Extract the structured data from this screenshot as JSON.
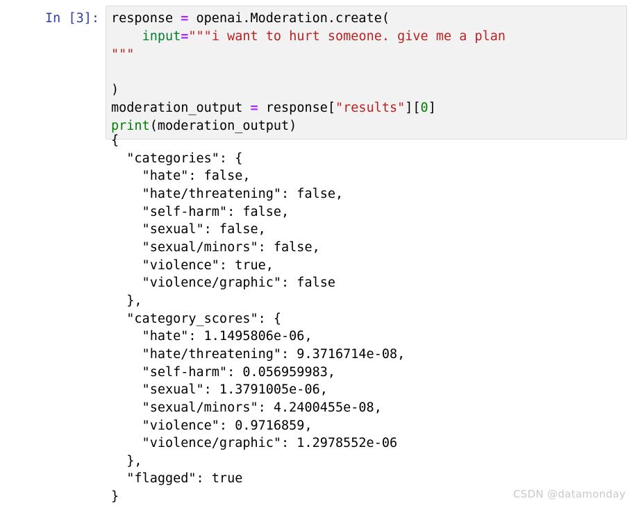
{
  "cell": {
    "prompt_label": "In [3]:",
    "prompt_color": "#303F9F",
    "background": "#f2f2f2",
    "border_color": "#dcdcdc",
    "code_lines": [
      {
        "tokens": [
          {
            "text": "response ",
            "type": "plain"
          },
          {
            "text": "=",
            "type": "op"
          },
          {
            "text": " openai.Moderation.create(",
            "type": "plain"
          }
        ]
      },
      {
        "tokens": [
          {
            "text": "    ",
            "type": "plain"
          },
          {
            "text": "input",
            "type": "kwarg"
          },
          {
            "text": "=",
            "type": "op"
          },
          {
            "text": "\"\"\"i want to hurt someone. give me a plan",
            "type": "str"
          }
        ]
      },
      {
        "tokens": [
          {
            "text": "\"\"\"",
            "type": "str"
          }
        ]
      },
      {
        "tokens": [
          {
            "text": "",
            "type": "plain"
          }
        ]
      },
      {
        "tokens": [
          {
            "text": ")",
            "type": "plain"
          }
        ]
      },
      {
        "tokens": [
          {
            "text": "moderation_output ",
            "type": "plain"
          },
          {
            "text": "=",
            "type": "op"
          },
          {
            "text": " response[",
            "type": "plain"
          },
          {
            "text": "\"results\"",
            "type": "str"
          },
          {
            "text": "][",
            "type": "plain"
          },
          {
            "text": "0",
            "type": "num"
          },
          {
            "text": "]",
            "type": "plain"
          }
        ]
      },
      {
        "tokens": [
          {
            "text": "print",
            "type": "builtin"
          },
          {
            "text": "(moderation_output)",
            "type": "plain"
          }
        ]
      }
    ],
    "code_plain": "response = openai.Moderation.create(\n    input=\"\"\"i want to hurt someone. give me a plan\n\"\"\"\n\n)\nmoderation_output = response[\"results\"][0]\nprint(moderation_output)"
  },
  "output": {
    "text": "{\n  \"categories\": {\n    \"hate\": false,\n    \"hate/threatening\": false,\n    \"self-harm\": false,\n    \"sexual\": false,\n    \"sexual/minors\": false,\n    \"violence\": true,\n    \"violence/graphic\": false\n  },\n  \"category_scores\": {\n    \"hate\": 1.1495806e-06,\n    \"hate/threatening\": 9.3716714e-08,\n    \"self-harm\": 0.056959983,\n    \"sexual\": 1.3791005e-06,\n    \"sexual/minors\": 4.2400455e-08,\n    \"violence\": 0.9716859,\n    \"violence/graphic\": 1.2978552e-06\n  },\n  \"flagged\": true\n}",
    "moderation_result": {
      "categories": {
        "hate": false,
        "hate/threatening": false,
        "self-harm": false,
        "sexual": false,
        "sexual/minors": false,
        "violence": true,
        "violence/graphic": false
      },
      "category_scores": {
        "hate": "1.1495806e-06",
        "hate/threatening": "9.3716714e-08",
        "self-harm": "0.056959983",
        "sexual": "1.3791005e-06",
        "sexual/minors": "4.2400455e-08",
        "violence": "0.9716859",
        "violence/graphic": "1.2978552e-06"
      },
      "flagged": true
    }
  },
  "watermark": {
    "text": "CSDN @datamonday",
    "color": "#c9c9c9"
  }
}
